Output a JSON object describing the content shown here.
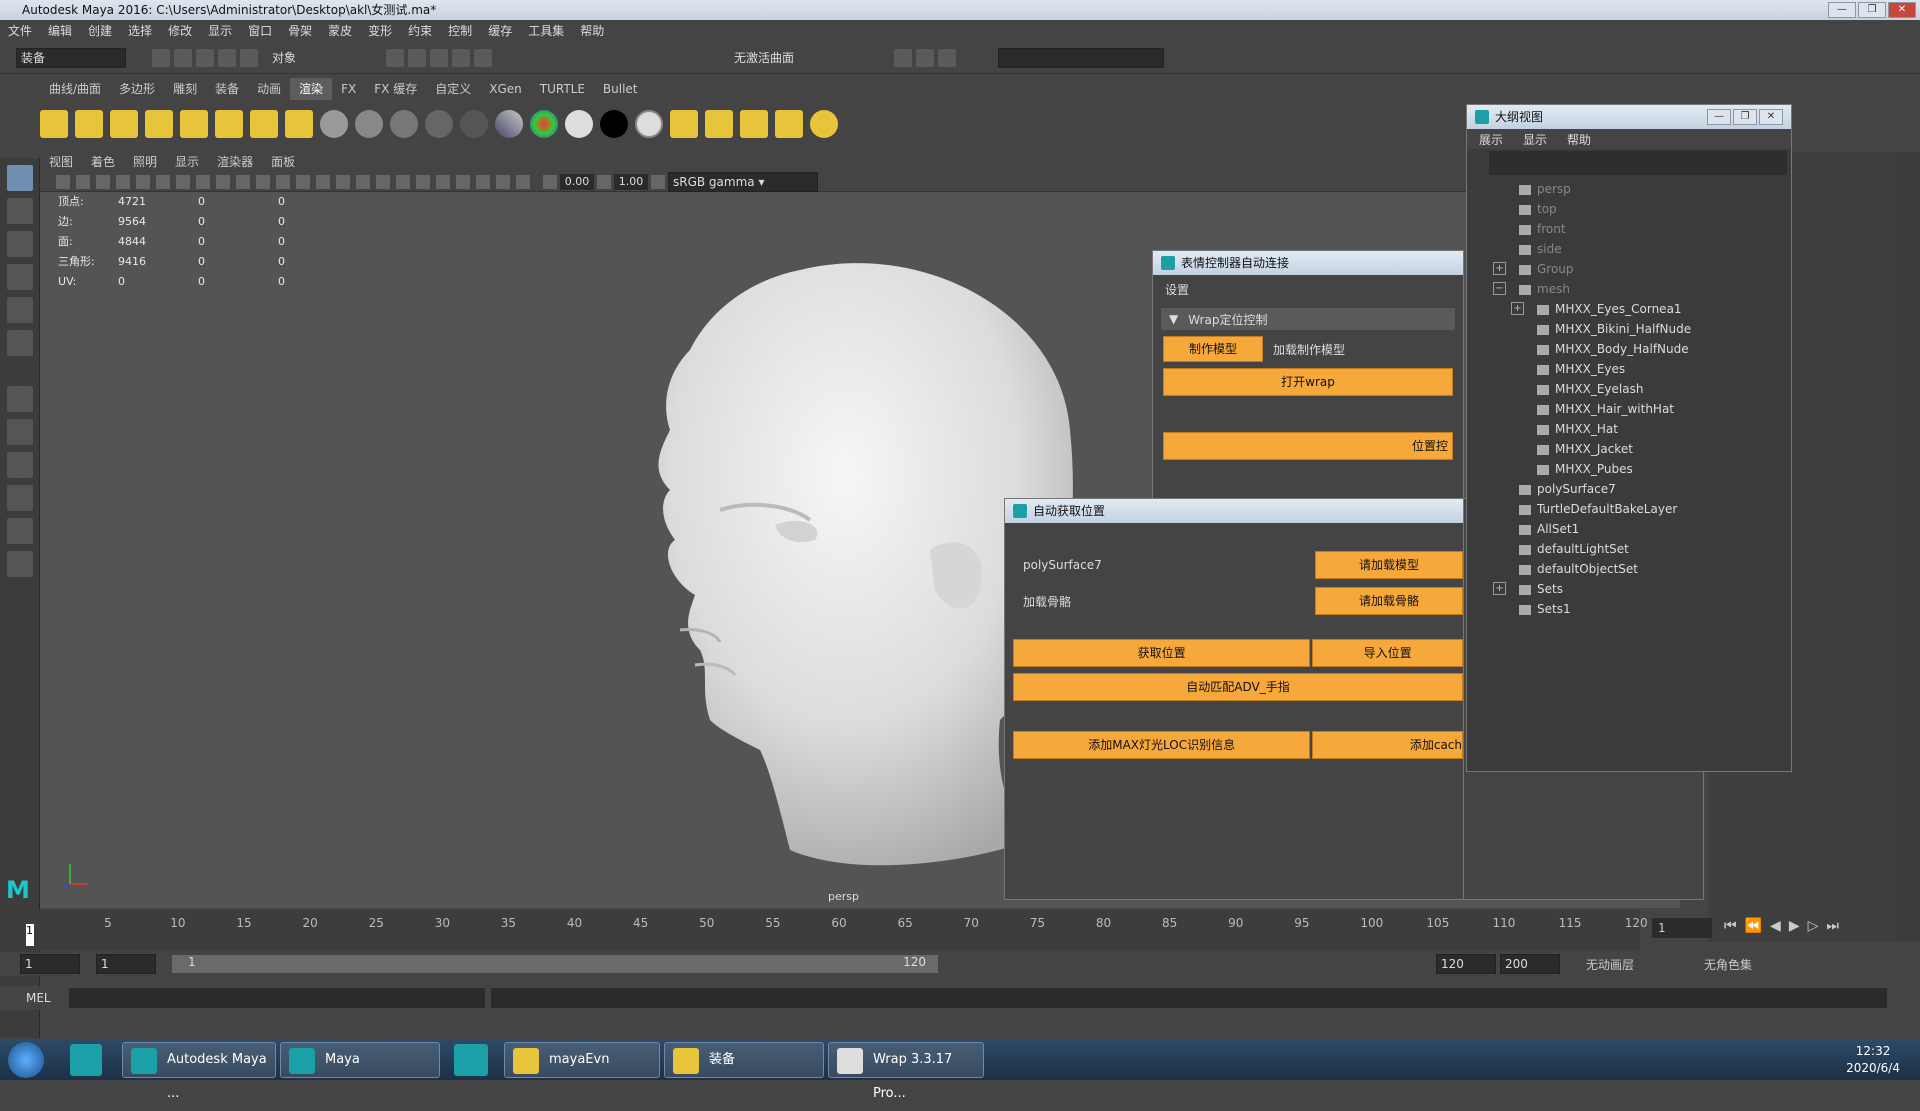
{
  "window": {
    "title": "Autodesk Maya 2016: C:\\Users\\Administrator\\Desktop\\akl\\女测试.ma*"
  },
  "menu": [
    "文件",
    "编辑",
    "创建",
    "选择",
    "修改",
    "显示",
    "窗口",
    "骨架",
    "蒙皮",
    "变形",
    "约束",
    "控制",
    "缓存",
    "工具集",
    "帮助"
  ],
  "statusline": {
    "mode": "装备",
    "objects": "对象",
    "live_surface": "无激活曲面"
  },
  "shelf_tabs": [
    "曲线/曲面",
    "多边形",
    "雕刻",
    "装备",
    "动画",
    "渲染",
    "FX",
    "FX 缓存",
    "自定义",
    "XGen",
    "TURTLE",
    "Bullet"
  ],
  "shelf_active": "渲染",
  "panel_menu": [
    "视图",
    "着色",
    "照明",
    "显示",
    "渲染器",
    "面板"
  ],
  "panel_toolbar": {
    "exposure": "0.00",
    "gamma": "1.00",
    "colorspace": "sRGB gamma"
  },
  "hud": [
    {
      "label": "顶点:",
      "a": "4721",
      "b": "0",
      "c": "0"
    },
    {
      "label": "边:",
      "a": "9564",
      "b": "0",
      "c": "0"
    },
    {
      "label": "面:",
      "a": "4844",
      "b": "0",
      "c": "0"
    },
    {
      "label": "三角形:",
      "a": "9416",
      "b": "0",
      "c": "0"
    },
    {
      "label": "UV:",
      "a": "0",
      "b": "0",
      "c": "0"
    }
  ],
  "viewport_label": "persp",
  "dlg1": {
    "title": "表情控制器自动连接",
    "settings": "设置",
    "section": "Wrap定位控制",
    "make_model": "制作模型",
    "load_make_model": "加载制作模型",
    "open_wrap": "打开wrap",
    "position": "位置控"
  },
  "dlg2": {
    "title": "自动获取位置",
    "poly_label": "polySurface7",
    "load_model": "请加载模型",
    "skeleton_label": "加载骨骼",
    "load_skeleton": "请加载骨骼",
    "get_position": "获取位置",
    "import_position": "导入位置",
    "auto_match": "自动匹配ADV_手指",
    "add_max": "添加MAX灯光LOC识别信息",
    "add_cache": "添加cach"
  },
  "outliner": {
    "title": "大纲视图",
    "menu": [
      "展示",
      "显示",
      "帮助"
    ],
    "items": [
      {
        "label": "persp",
        "indent": 1,
        "dim": true
      },
      {
        "label": "top",
        "indent": 1,
        "dim": true
      },
      {
        "label": "front",
        "indent": 1,
        "dim": true
      },
      {
        "label": "side",
        "indent": 1,
        "dim": true
      },
      {
        "label": "Group",
        "indent": 1,
        "dim": true,
        "exp": "+"
      },
      {
        "label": "mesh",
        "indent": 1,
        "dim": true,
        "exp": "-"
      },
      {
        "label": "MHXX_Eyes_Cornea1",
        "indent": 2,
        "exp": "+"
      },
      {
        "label": "MHXX_Bikini_HalfNude",
        "indent": 2
      },
      {
        "label": "MHXX_Body_HalfNude",
        "indent": 2
      },
      {
        "label": "MHXX_Eyes",
        "indent": 2
      },
      {
        "label": "MHXX_Eyelash",
        "indent": 2
      },
      {
        "label": "MHXX_Hair_withHat",
        "indent": 2
      },
      {
        "label": "MHXX_Hat",
        "indent": 2
      },
      {
        "label": "MHXX_Jacket",
        "indent": 2
      },
      {
        "label": "MHXX_Pubes",
        "indent": 2
      },
      {
        "label": "polySurface7",
        "indent": 1
      },
      {
        "label": "TurtleDefaultBakeLayer",
        "indent": 1
      },
      {
        "label": "AllSet1",
        "indent": 1
      },
      {
        "label": "defaultLightSet",
        "indent": 1
      },
      {
        "label": "defaultObjectSet",
        "indent": 1
      },
      {
        "label": "Sets",
        "indent": 1,
        "exp": "+"
      },
      {
        "label": "Sets1",
        "indent": 1
      }
    ]
  },
  "timeline": {
    "ticks": [
      "5",
      "10",
      "15",
      "20",
      "25",
      "30",
      "35",
      "40",
      "45",
      "50",
      "55",
      "60",
      "65",
      "70",
      "75",
      "80",
      "85",
      "90",
      "95",
      "100",
      "105",
      "110",
      "115",
      "120"
    ],
    "start": "1",
    "current": "1"
  },
  "range": {
    "a": "1",
    "b": "1",
    "c": "1",
    "slider_end": "120",
    "end": "120",
    "max": "200",
    "anim_layer": "无动画层",
    "char_set": "无角色集"
  },
  "mel": "MEL",
  "taskbar": {
    "items": [
      "Autodesk Maya ...",
      "Maya",
      "mayaEvn",
      "装备",
      "Wrap 3.3.17 Pro..."
    ],
    "time": "12:32",
    "date": "2020/6/4"
  }
}
